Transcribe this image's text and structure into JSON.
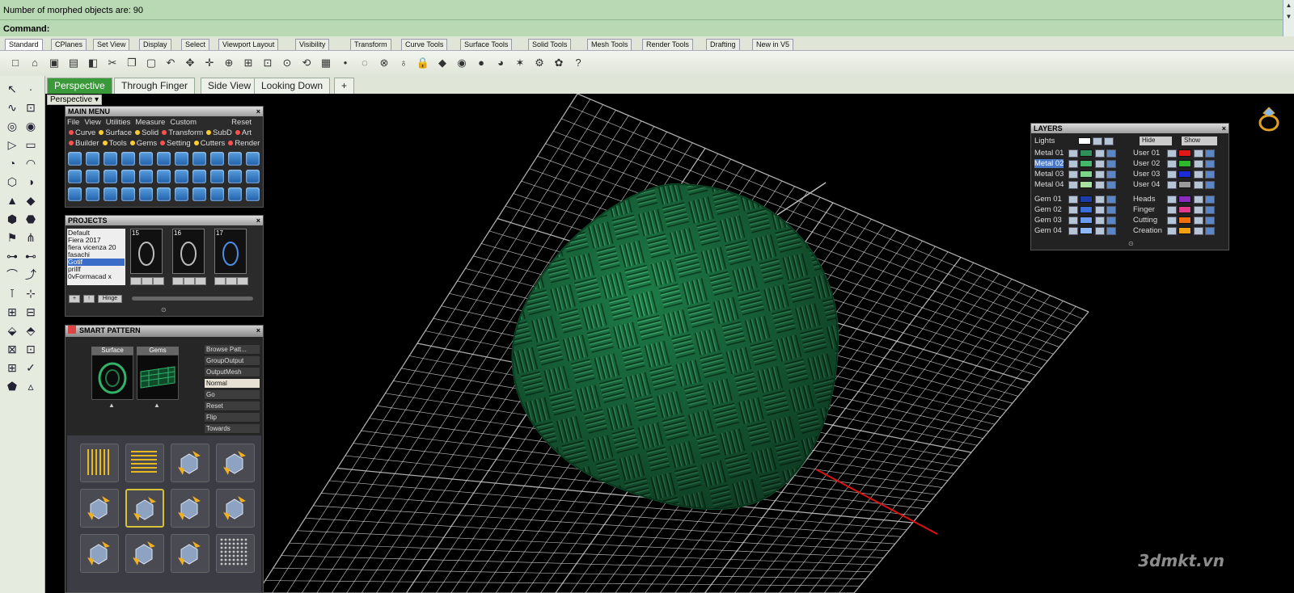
{
  "command_area": {
    "history_line": "Number of morphed objects are: 90",
    "command_prompt": "Command:"
  },
  "toolbar_tabs": [
    "Standard",
    "CPlanes",
    "Set View",
    "Display",
    "Select",
    "Viewport Layout",
    "Visibility",
    "Transform",
    "Curve Tools",
    "Surface Tools",
    "Solid Tools",
    "Mesh Tools",
    "Render Tools",
    "Drafting",
    "New in V5"
  ],
  "toolbar_icons": [
    "new-file-icon",
    "open-icon",
    "save-icon",
    "print-icon",
    "import-icon",
    "cut-icon",
    "copy-icon",
    "paste-icon",
    "undo-icon",
    "pan-icon",
    "move-icon",
    "zoom-extents-icon",
    "zoom-window-icon",
    "zoom-selected-icon",
    "zoom-icon",
    "rotate-view-icon",
    "grid-icon",
    "point-icon",
    "hide-icon",
    "lock-icon",
    "light-icon",
    "lock-object-icon",
    "layer-icon",
    "color-wheel-icon",
    "shade-icon",
    "render-sphere-icon",
    "material-icon",
    "options-icon",
    "gear-icon",
    "help-icon"
  ],
  "viewport_tabs": [
    "Perspective",
    "Through Finger",
    "Side View",
    "Looking Down",
    "+"
  ],
  "viewport_label": "Perspective",
  "main_menu": {
    "title": "MAIN MENU",
    "menubar": [
      "File",
      "View",
      "Utilities",
      "Measure",
      "Custom"
    ],
    "reset": "Reset",
    "row1": [
      "Curve",
      "Surface",
      "Solid",
      "Transform",
      "SubD",
      "Art"
    ],
    "row2": [
      "Builder",
      "Tools",
      "Gems",
      "Setting",
      "Cutters",
      "Render"
    ]
  },
  "projects": {
    "title": "PROJECTS",
    "list": [
      "Default",
      "Fiera 2017",
      "fiera vicenza 20",
      "fasachi",
      "Gotif",
      "prillf",
      "0vFormacad x"
    ],
    "selected": "Gotif",
    "thumb_numbers": [
      "15",
      "16",
      "17"
    ],
    "footer_btn": "Hinge"
  },
  "smart_pattern": {
    "title": "SMART PATTERN",
    "slot1": "Surface",
    "slot2": "Gems",
    "options": [
      "Browse Patt...",
      "GroupOutput",
      "OutputMesh",
      "Normal",
      "Go",
      "Reset",
      "Flip",
      "Towards"
    ]
  },
  "layers": {
    "title": "LAYERS",
    "lights": "Lights",
    "hide": "Hide",
    "show": "Show",
    "left_group1": [
      {
        "name": "Metal 01",
        "color": "#2f8f5a"
      },
      {
        "name": "Metal 02",
        "color": "#44b86a"
      },
      {
        "name": "Metal 03",
        "color": "#7cd48a"
      },
      {
        "name": "Metal 04",
        "color": "#a8e0a0"
      }
    ],
    "left_group2": [
      {
        "name": "Gem 01",
        "color": "#1c3da8"
      },
      {
        "name": "Gem 02",
        "color": "#3b6fd8"
      },
      {
        "name": "Gem 03",
        "color": "#6a9cf0"
      },
      {
        "name": "Gem 04",
        "color": "#8fb8f8"
      }
    ],
    "right_group1": [
      {
        "name": "User 01",
        "color": "#e01818"
      },
      {
        "name": "User 02",
        "color": "#2db82d"
      },
      {
        "name": "User 03",
        "color": "#1c2cd8"
      },
      {
        "name": "User 04",
        "color": "#9a9a9a"
      }
    ],
    "right_group2": [
      {
        "name": "Heads",
        "color": "#8a2bbf"
      },
      {
        "name": "Finger",
        "color": "#e03a8a"
      },
      {
        "name": "Cutting",
        "color": "#f07010"
      },
      {
        "name": "Creation",
        "color": "#f0a010"
      }
    ]
  },
  "watermark": "3dmkt.vn",
  "colors": {
    "accent": "#3a9a3a",
    "command_bg": "#b9d9b5",
    "model_green": "#1f8a4f",
    "grid": "#d8d8d8"
  }
}
